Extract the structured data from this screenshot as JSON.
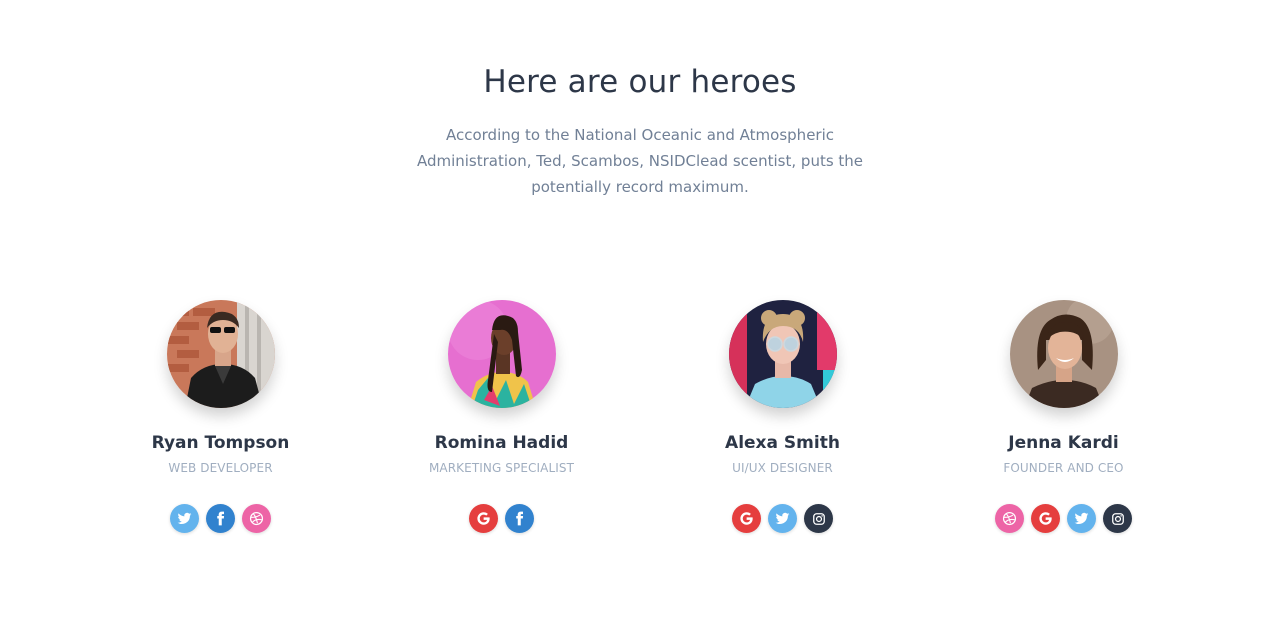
{
  "section": {
    "title": "Here are our heroes",
    "subtitle": "According to the National Oceanic and Atmospheric Administration, Ted, Scambos, NSIDClead scentist, puts the potentially record maximum."
  },
  "colors": {
    "heading": "#2d3748",
    "subtitle": "#718096",
    "role": "#a0aec0",
    "twitter": "#63b3ed",
    "facebook": "#3182ce",
    "dribbble": "#ed64a6",
    "google": "#e53e3e",
    "instagram": "#2d3748"
  },
  "team": [
    {
      "name": "Ryan Tompson",
      "role": "Web Developer",
      "avatar": "avatar-ryan",
      "socials": [
        "twitter-icon",
        "facebook-icon",
        "dribbble-icon"
      ]
    },
    {
      "name": "Romina Hadid",
      "role": "Marketing Specialist",
      "avatar": "avatar-romina",
      "socials": [
        "google-icon",
        "facebook-icon"
      ]
    },
    {
      "name": "Alexa Smith",
      "role": "UI/UX Designer",
      "avatar": "avatar-alexa",
      "socials": [
        "google-icon",
        "twitter-icon",
        "instagram-icon"
      ]
    },
    {
      "name": "Jenna Kardi",
      "role": "Founder and CEO",
      "avatar": "avatar-jenna",
      "socials": [
        "dribbble-icon",
        "google-icon",
        "twitter-icon",
        "instagram-icon"
      ]
    }
  ]
}
